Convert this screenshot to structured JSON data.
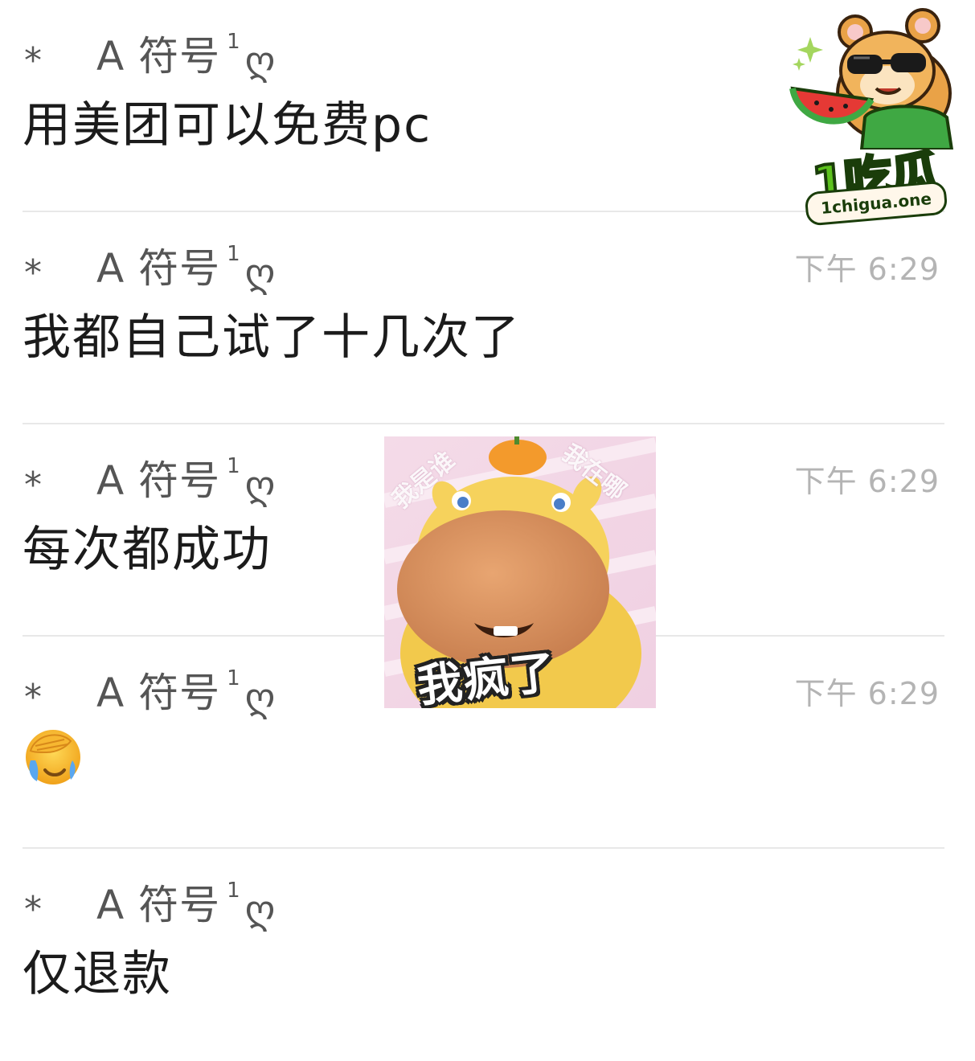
{
  "sender": {
    "icon": "star-icon",
    "star": "*",
    "name": "A 符号",
    "sup": "1",
    "glyph": "ღ"
  },
  "messages": [
    {
      "text": "用美团可以免费pc",
      "time": ""
    },
    {
      "text": "我都自己试了十几次了",
      "time": "下午 6:29"
    },
    {
      "text": "每次都成功",
      "time": "下午 6:29"
    },
    {
      "text": "",
      "emoji": "facepalm-crying-emoji-icon",
      "time": "下午 6:29"
    },
    {
      "text": "仅退款",
      "time": ""
    }
  ],
  "watermark": {
    "brand": "1吃瓜",
    "url": "1chigua.one"
  },
  "sticker": {
    "caption": "我疯了",
    "wm_left": "我是谁",
    "wm_right": "我在哪"
  },
  "colors": {
    "text": "#1b1b1b",
    "sender": "#555555",
    "timestamp": "#b4b4b4",
    "divider": "#e8e8e8",
    "logo_green": "#5cc21c"
  }
}
